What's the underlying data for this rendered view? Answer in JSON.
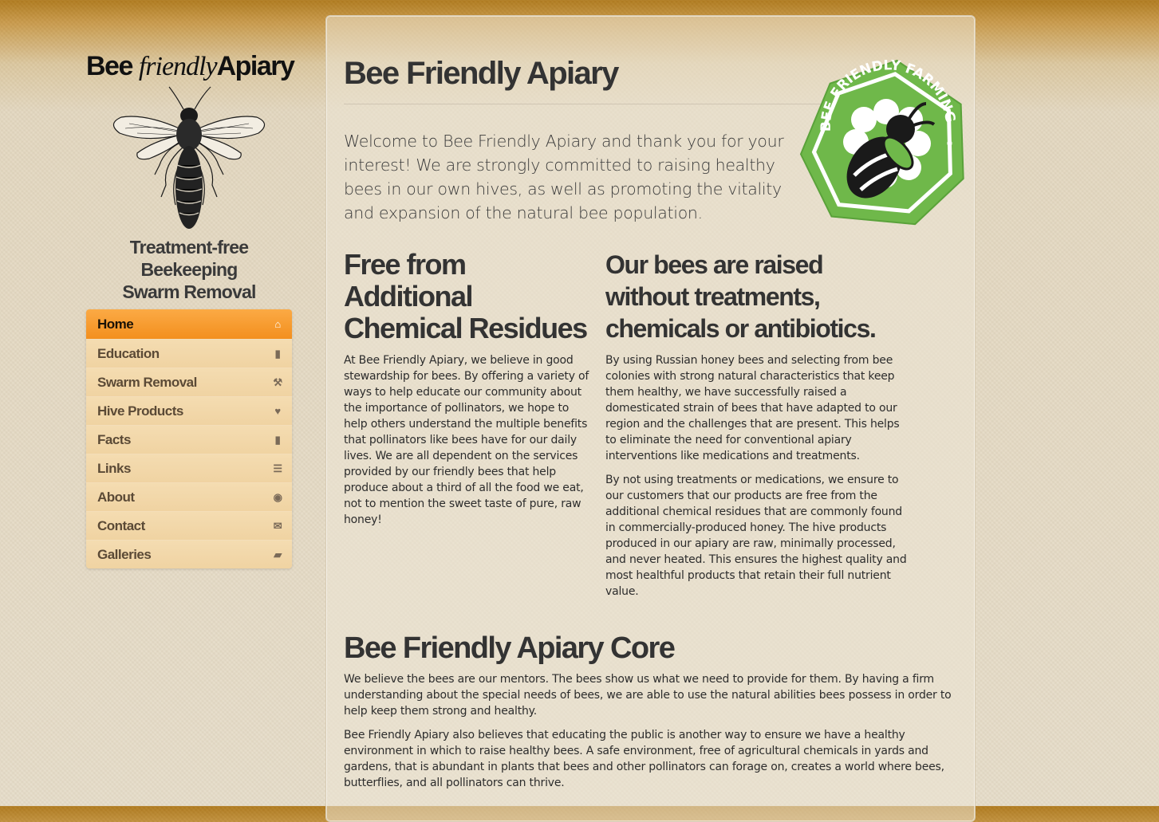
{
  "sidebar": {
    "logo": {
      "word1": "Bee",
      "word2": "friendly",
      "word3": "Apiary"
    },
    "tagline": {
      "line1": "Treatment-free Beekeeping",
      "line2": "Swarm Removal"
    },
    "nav": [
      {
        "label": "Home",
        "icon": "home-icon",
        "glyph": "⌂",
        "active": true
      },
      {
        "label": "Education",
        "icon": "book-icon",
        "glyph": "▮"
      },
      {
        "label": "Swarm Removal",
        "icon": "wrench-icon",
        "glyph": "⚒"
      },
      {
        "label": "Hive Products",
        "icon": "heart-icon",
        "glyph": "♥"
      },
      {
        "label": "Facts",
        "icon": "book-icon",
        "glyph": "▮"
      },
      {
        "label": "Links",
        "icon": "list-icon",
        "glyph": "☰"
      },
      {
        "label": "About",
        "icon": "globe-icon",
        "glyph": "◉"
      },
      {
        "label": "Contact",
        "icon": "envelope-icon",
        "glyph": "✉"
      },
      {
        "label": "Galleries",
        "icon": "folder-open-icon",
        "glyph": "▰"
      }
    ]
  },
  "main": {
    "title": "Bee Friendly Apiary",
    "badge": {
      "text": "BEE FRIENDLY FARMING",
      "reg": "®"
    },
    "intro": "Welcome to Bee Friendly Apiary and thank you for your interest! We are strongly committed to raising healthy bees in our own hives, as well as promoting the vitality and expansion of the natural bee population.",
    "left_col": {
      "heading": "Free from Additional Chemical Residues",
      "paragraphs": [
        "At Bee Friendly Apiary, we believe in good stewardship for bees. By offering a variety of ways to help educate our community about the importance of pollinators, we hope to help others understand the multiple benefits that pollinators like bees have for our daily lives. We are all dependent on the services provided by our friendly bees that help produce about a third of all the food we eat, not to mention the sweet taste of pure, raw honey!"
      ]
    },
    "right_col": {
      "heading": "Our bees are raised without treatments, chemicals or antibiotics.",
      "paragraphs": [
        "By using Russian honey bees and selecting from bee colonies with strong natural characteristics that keep them healthy, we have successfully raised a domesticated strain of bees that have adapted to our region and the challenges that are present. This helps to eliminate the need for conventional apiary interventions like medications and treatments.",
        "By not using treatments or medications, we ensure to our customers that our products are free from the additional chemical residues that are commonly found in commercially-produced honey. The hive products produced in our apiary are raw, minimally processed, and never heated. This ensures the highest quality and most healthful products that retain their full nutrient value."
      ]
    },
    "core": {
      "heading": "Bee Friendly Apiary Core",
      "paragraphs": [
        "We believe the bees are our mentors. The bees show us what we need to provide for them. By having a firm understanding about the special needs of bees, we are able to use the natural abilities bees possess in order to help keep them strong and healthy.",
        "Bee Friendly Apiary also believes that educating the public is another way to ensure we have a healthy environment in which to raise healthy bees. A safe environment, free of agricultural chemicals in yards and gardens, that is abundant in plants that bees and other pollinators can forage on, creates a world where bees, butterflies, and all pollinators can thrive."
      ]
    }
  },
  "colors": {
    "accent": "#f79a2a",
    "badge_green": "#6fb84a",
    "nav_bg": "#f2d8a9",
    "text": "#2e2e2e"
  }
}
